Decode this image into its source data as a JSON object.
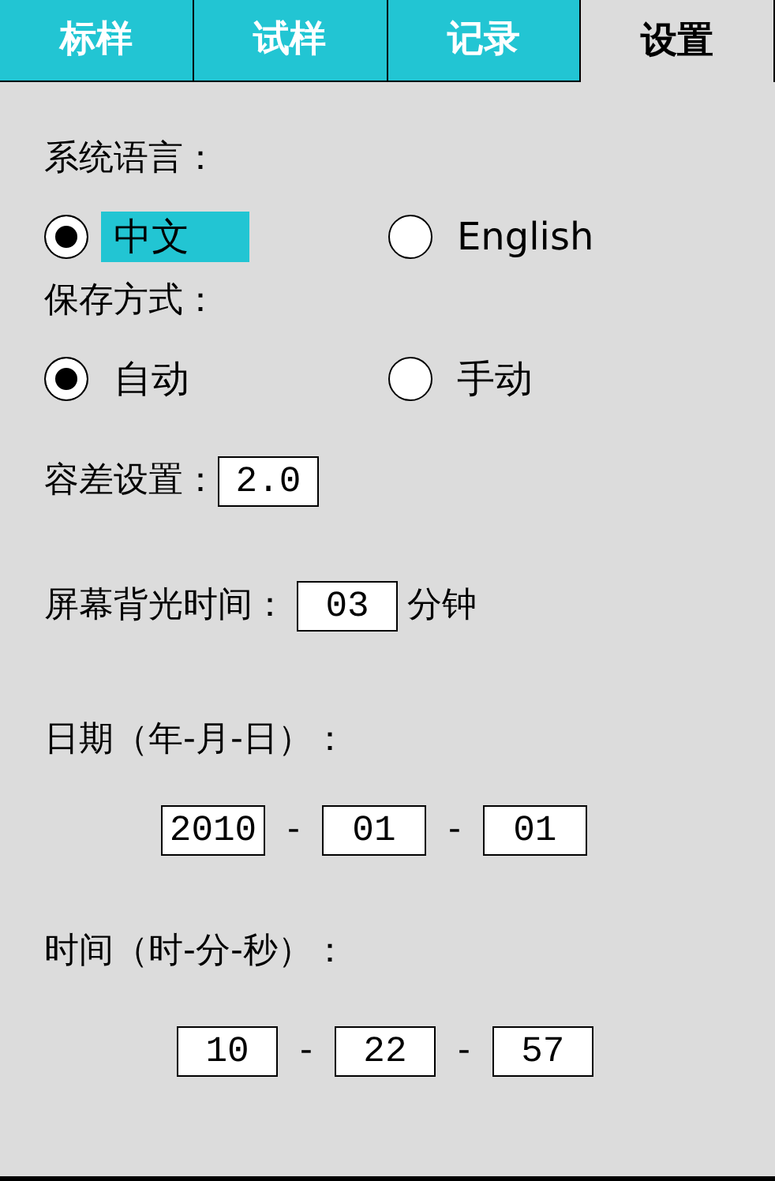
{
  "tabs": [
    {
      "label": "标样",
      "selected": false
    },
    {
      "label": "试样",
      "selected": false
    },
    {
      "label": "记录",
      "selected": false
    },
    {
      "label": "设置",
      "selected": true
    }
  ],
  "language": {
    "label": "系统语言：",
    "options": [
      {
        "label": "中文",
        "selected": true,
        "highlighted": true
      },
      {
        "label": "English",
        "selected": false,
        "highlighted": false
      }
    ]
  },
  "save_mode": {
    "label": "保存方式：",
    "options": [
      {
        "label": "自动",
        "selected": true,
        "highlighted": false
      },
      {
        "label": "手动",
        "selected": false,
        "highlighted": false
      }
    ]
  },
  "tolerance": {
    "label": "容差设置：",
    "value": "2.0"
  },
  "backlight": {
    "label": "屏幕背光时间：",
    "value": "03",
    "unit": "分钟"
  },
  "date": {
    "label": "日期（年-月-日）：",
    "parts": [
      "2010",
      "01",
      "01"
    ],
    "separator": "-"
  },
  "time": {
    "label": "时间（时-分-秒）：",
    "parts": [
      "10",
      "22",
      "57"
    ],
    "separator": "-"
  }
}
